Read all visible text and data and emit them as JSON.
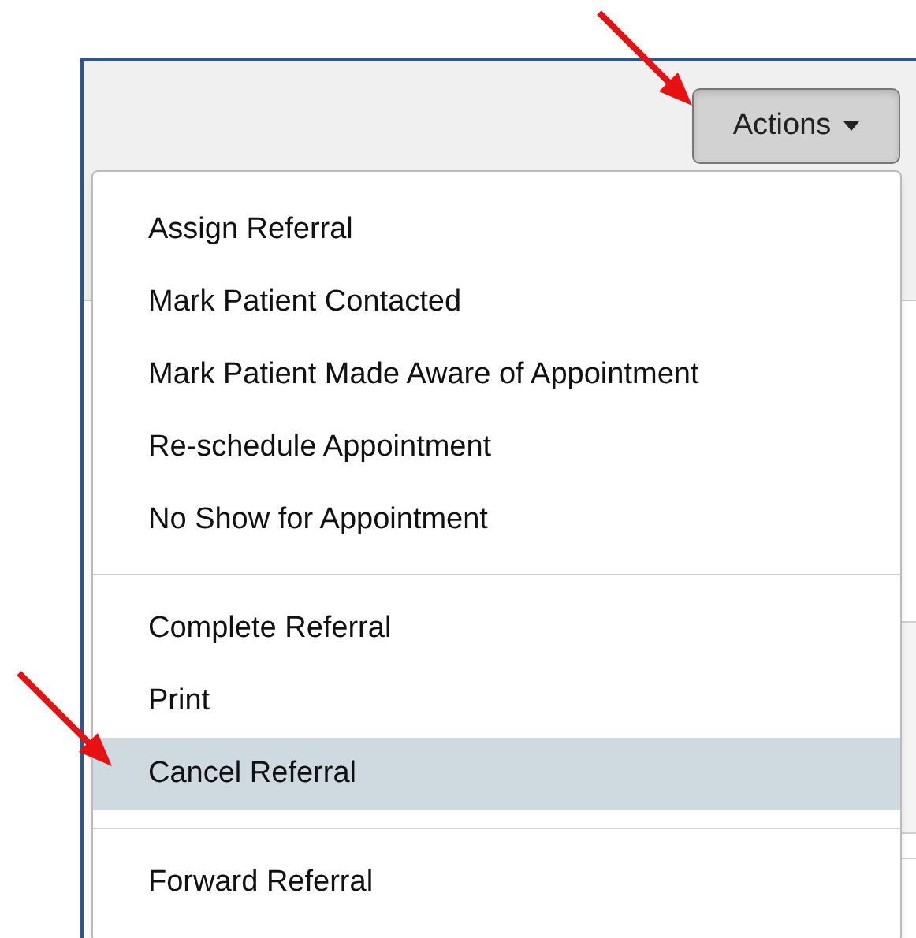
{
  "actions_button": {
    "label": "Actions",
    "expanded": true
  },
  "menu": {
    "groups": [
      {
        "items": [
          {
            "label": "Assign Referral",
            "selected": false
          },
          {
            "label": "Mark Patient Contacted",
            "selected": false
          },
          {
            "label": "Mark Patient Made Aware of Appointment",
            "selected": false
          },
          {
            "label": "Re-schedule Appointment",
            "selected": false
          },
          {
            "label": "No Show for Appointment",
            "selected": false
          }
        ]
      },
      {
        "items": [
          {
            "label": "Complete Referral",
            "selected": false
          },
          {
            "label": "Print",
            "selected": false
          },
          {
            "label": "Cancel Referral",
            "selected": true
          }
        ]
      },
      {
        "items": [
          {
            "label": "Forward Referral",
            "selected": false
          }
        ]
      }
    ]
  }
}
